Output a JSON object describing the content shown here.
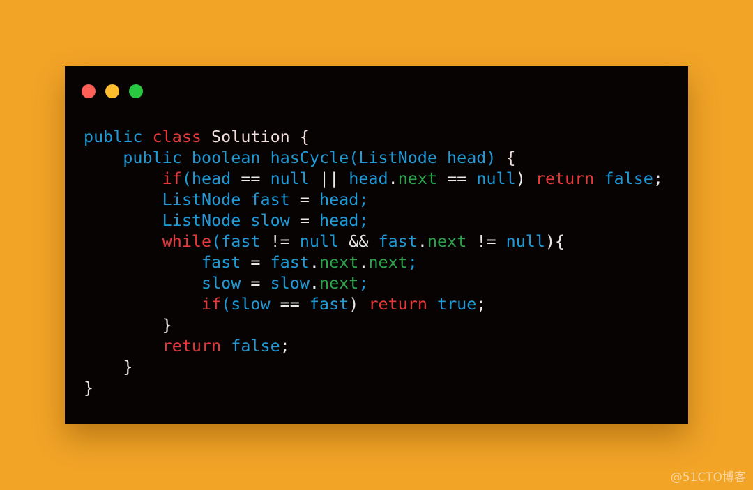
{
  "window": {
    "buttons": [
      {
        "name": "close",
        "color": "#fe5f57"
      },
      {
        "name": "minimize",
        "color": "#febc2e"
      },
      {
        "name": "maximize",
        "color": "#28c840"
      }
    ]
  },
  "colors": {
    "k": "#e5383b",
    "b": "#1f9ad6",
    "g": "#2ba24c",
    "w": "#f2dede",
    "p": "#e8e8e8"
  },
  "code": {
    "lines": [
      [
        [
          "public ",
          "b"
        ],
        [
          "class ",
          "k"
        ],
        [
          "Solution {",
          "w"
        ]
      ],
      [
        [
          "    public boolean hasCycle(ListNode head) ",
          "b"
        ],
        [
          "{",
          "w"
        ]
      ],
      [
        [
          "        "
        ],
        [
          "if",
          "k"
        ],
        [
          "(head ",
          "b"
        ],
        [
          "== ",
          "p"
        ],
        [
          "null ",
          "b"
        ],
        [
          "|| ",
          "p"
        ],
        [
          "head",
          "b"
        ],
        [
          ".",
          "p"
        ],
        [
          "next ",
          "g"
        ],
        [
          "== ",
          "p"
        ],
        [
          "null",
          "b"
        ],
        [
          ") ",
          "p"
        ],
        [
          "return ",
          "k"
        ],
        [
          "false",
          "b"
        ],
        [
          ";",
          "p"
        ]
      ],
      [
        [
          "        ListNode fast ",
          "b"
        ],
        [
          "= ",
          "p"
        ],
        [
          "head;",
          "b"
        ]
      ],
      [
        [
          "        ListNode slow ",
          "b"
        ],
        [
          "= ",
          "p"
        ],
        [
          "head;",
          "b"
        ]
      ],
      [
        [
          "        "
        ],
        [
          "while",
          "k"
        ],
        [
          "(fast ",
          "b"
        ],
        [
          "!= ",
          "p"
        ],
        [
          "null ",
          "b"
        ],
        [
          "&& ",
          "p"
        ],
        [
          "fast",
          "b"
        ],
        [
          ".",
          "p"
        ],
        [
          "next ",
          "g"
        ],
        [
          "!= ",
          "p"
        ],
        [
          "null",
          "b"
        ],
        [
          "){",
          "p"
        ]
      ],
      [
        [
          "            fast ",
          "b"
        ],
        [
          "= ",
          "p"
        ],
        [
          "fast",
          "b"
        ],
        [
          ".",
          "p"
        ],
        [
          "next",
          "g"
        ],
        [
          ".",
          "p"
        ],
        [
          "next",
          "g"
        ],
        [
          ";",
          "b"
        ]
      ],
      [
        [
          "            slow ",
          "b"
        ],
        [
          "= ",
          "p"
        ],
        [
          "slow",
          "b"
        ],
        [
          ".",
          "p"
        ],
        [
          "next",
          "g"
        ],
        [
          ";",
          "b"
        ]
      ],
      [
        [
          "            "
        ],
        [
          "if",
          "k"
        ],
        [
          "(slow ",
          "b"
        ],
        [
          "== ",
          "p"
        ],
        [
          "fast",
          "b"
        ],
        [
          ") ",
          "p"
        ],
        [
          "return ",
          "k"
        ],
        [
          "true",
          "b"
        ],
        [
          ";",
          "p"
        ]
      ],
      [
        [
          "        }",
          "p"
        ]
      ],
      [
        [
          "        "
        ],
        [
          "return ",
          "k"
        ],
        [
          "false",
          "b"
        ],
        [
          ";",
          "p"
        ]
      ],
      [
        [
          "    }",
          "p"
        ]
      ],
      [
        [
          "}",
          "p"
        ]
      ]
    ]
  },
  "watermark": "@51CTO博客"
}
